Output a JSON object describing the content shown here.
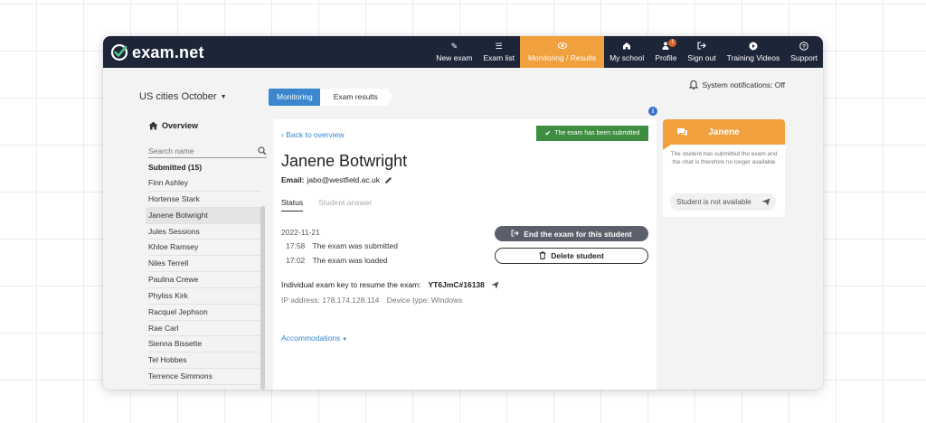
{
  "app": {
    "name": "exam.net",
    "colors": {
      "nav_bg": "#1d2538",
      "accent_orange": "#f0a03c",
      "link_blue": "#3a86cf",
      "success_green": "#3e8e41"
    }
  },
  "nav": {
    "items": [
      {
        "label": "New exam",
        "icon": "pencil-icon"
      },
      {
        "label": "Exam list",
        "icon": "list-icon"
      },
      {
        "label": "Monitoring / Results",
        "icon": "eye-icon",
        "active": true
      },
      {
        "label": "My school",
        "icon": "home-icon"
      },
      {
        "label": "Profile",
        "icon": "user-icon",
        "badge": "!"
      },
      {
        "label": "Sign out",
        "icon": "sign-out-icon"
      },
      {
        "label": "Training Videos",
        "icon": "play-icon"
      },
      {
        "label": "Support",
        "icon": "question-icon"
      }
    ]
  },
  "exam": {
    "title": "US cities October"
  },
  "breadcrumb": {
    "step1": "Monitoring",
    "step2": "Exam results"
  },
  "notifications": {
    "label": "System notifications: Off"
  },
  "sidebar": {
    "overview_label": "Overview",
    "search_placeholder": "Search name",
    "submitted_heading": "Submitted (15)",
    "students": [
      "Finn Ashley",
      "Hortense Stark",
      "Janene Botwright",
      "Jules Sessions",
      "Khloe Ramsey",
      "Niles Terrell",
      "Paulina Crewe",
      "Phyliss Kirk",
      "Racquel Jephson",
      "Rae Carl",
      "Sienna Bissette",
      "Tel Hobbes",
      "Terrence Simmons"
    ],
    "selected_student": "Janene Botwright"
  },
  "student": {
    "back_label": "Back to overview",
    "submitted_badge": "The exam has been submitted",
    "name": "Janene Botwright",
    "email_label": "Email:",
    "email": "jabo@westfield.ac.uk",
    "tabs": {
      "status": "Status",
      "answer": "Student answer"
    },
    "date": "2022-11-21",
    "events": [
      {
        "time": "17:58",
        "text": "The exam was submitted"
      },
      {
        "time": "17:02",
        "text": "The exam was loaded"
      }
    ],
    "end_button": "End the exam for this student",
    "delete_button": "Delete student",
    "key_label": "Individual exam key to resume the exam:",
    "key_code": "YT6JmC#16138",
    "ip_label": "IP address: 178.174.128.114",
    "device_label": "Device type: Windows",
    "accommodations": "Accommodations"
  },
  "chat": {
    "name": "Janene",
    "message": "The student has submitted the exam and the chat is therefore no longer available",
    "input_placeholder": "Student is not available"
  }
}
